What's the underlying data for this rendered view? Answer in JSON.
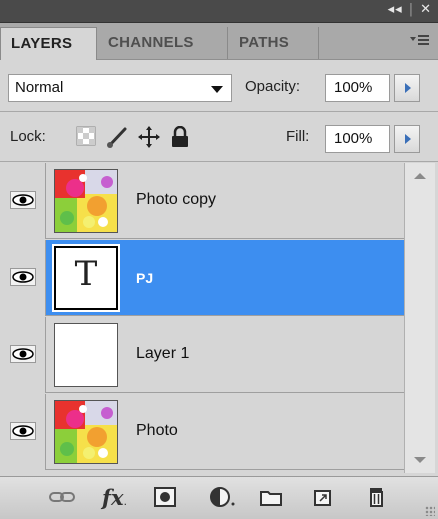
{
  "panel": {
    "title_buttons": {
      "collapse": "◂◂",
      "close": "✕"
    },
    "tabs": [
      {
        "label": "LAYERS",
        "active": true
      },
      {
        "label": "CHANNELS",
        "active": false
      },
      {
        "label": "PATHS",
        "active": false
      }
    ],
    "menu_icon": "panel-menu-icon"
  },
  "blend": {
    "mode": "Normal",
    "opacity_label": "Opacity:",
    "opacity_value": "100%"
  },
  "lock": {
    "label": "Lock:",
    "icons": [
      "lock-transparent-icon",
      "lock-image-icon",
      "lock-position-icon",
      "lock-all-icon"
    ],
    "fill_label": "Fill:",
    "fill_value": "100%"
  },
  "layers": [
    {
      "name": "Photo copy",
      "thumb": "photo",
      "visible": true,
      "selected": false
    },
    {
      "name": "PJ",
      "thumb": "text",
      "thumb_glyph": "T",
      "visible": true,
      "selected": true
    },
    {
      "name": "Layer 1",
      "thumb": "blank",
      "visible": true,
      "selected": false
    },
    {
      "name": "Photo",
      "thumb": "photo",
      "visible": true,
      "selected": false
    }
  ],
  "toolbar": {
    "icons": [
      "link-layers-icon",
      "fx-icon",
      "add-mask-icon",
      "adjustment-layer-icon",
      "new-group-icon",
      "new-layer-icon",
      "delete-layer-icon"
    ],
    "fx_label": "fx"
  },
  "colors": {
    "selected_row": "#3d8ef0",
    "panel_bg": "#d6d6d6",
    "title_bar": "#4a4a4a"
  }
}
